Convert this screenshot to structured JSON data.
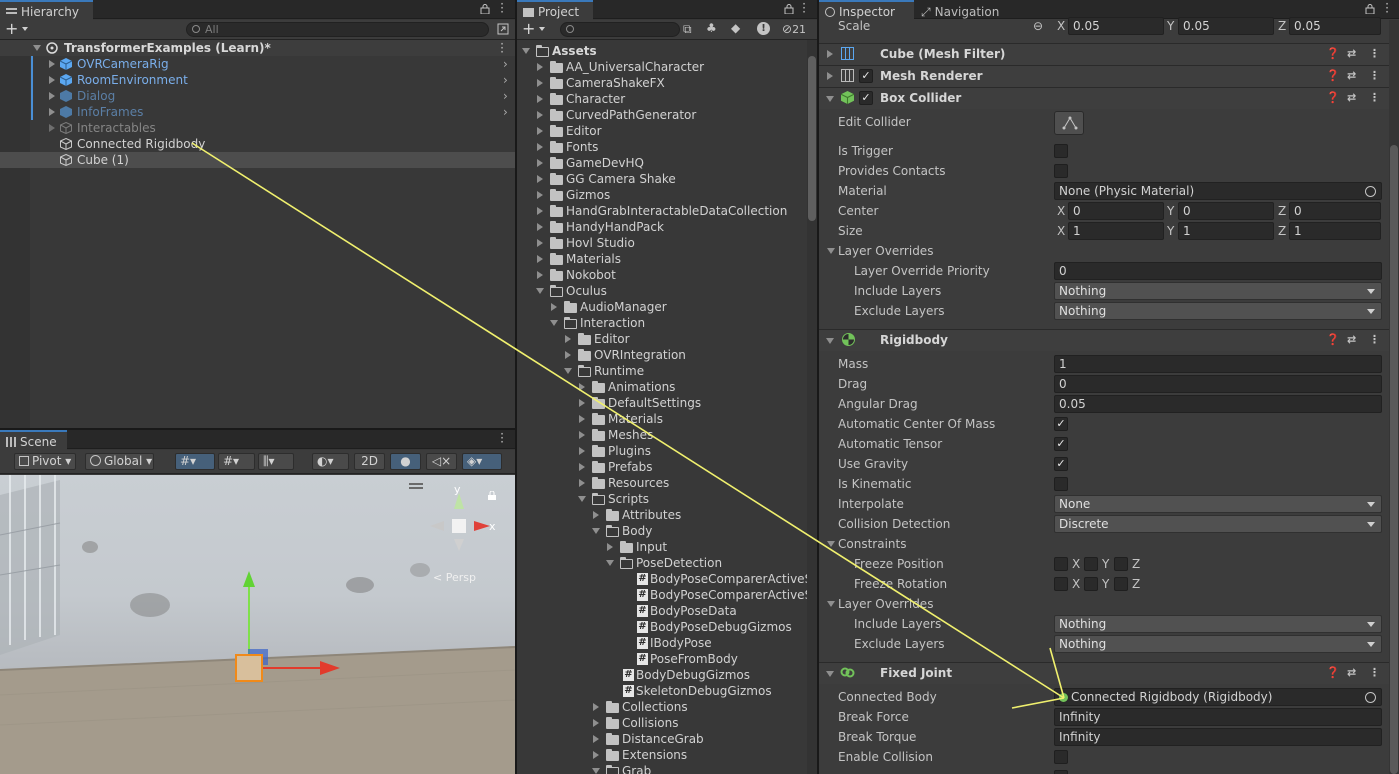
{
  "hierarchy": {
    "tab_label": "Hierarchy",
    "search_placeholder": "All",
    "scene_name": "TransformerExamples (Learn)*",
    "items": [
      {
        "label": "OVRCameraRig"
      },
      {
        "label": "RoomEnvironment"
      },
      {
        "label": "Dialog"
      },
      {
        "label": "InfoFrames"
      },
      {
        "label": "Interactables"
      },
      {
        "label": "Connected Rigidbody"
      },
      {
        "label": "Cube (1)"
      }
    ]
  },
  "scene": {
    "tab_label": "Scene",
    "pivot_label": "Pivot",
    "global_label": "Global",
    "mode_2d": "2D",
    "persp_label": "< Persp",
    "gizmo_x": "x",
    "gizmo_y": "y"
  },
  "project": {
    "tab_label": "Project",
    "hidden_count": "21",
    "root": "Assets",
    "items": [
      {
        "label": "AA_UniversalCharacter"
      },
      {
        "label": "CameraShakeFX"
      },
      {
        "label": "Character"
      },
      {
        "label": "CurvedPathGenerator"
      },
      {
        "label": "Editor"
      },
      {
        "label": "Fonts"
      },
      {
        "label": "GameDevHQ"
      },
      {
        "label": "GG Camera Shake"
      },
      {
        "label": "Gizmos"
      },
      {
        "label": "HandGrabInteractableDataCollection"
      },
      {
        "label": "HandyHandPack"
      },
      {
        "label": "Hovl Studio"
      },
      {
        "label": "Materials"
      },
      {
        "label": "Nokobot"
      },
      {
        "label": "Oculus"
      },
      {
        "label": "AudioManager"
      },
      {
        "label": "Interaction"
      },
      {
        "label": "Editor"
      },
      {
        "label": "OVRIntegration"
      },
      {
        "label": "Runtime"
      },
      {
        "label": "Animations"
      },
      {
        "label": "DefaultSettings"
      },
      {
        "label": "Materials"
      },
      {
        "label": "Meshes"
      },
      {
        "label": "Plugins"
      },
      {
        "label": "Prefabs"
      },
      {
        "label": "Resources"
      },
      {
        "label": "Scripts"
      },
      {
        "label": "Attributes"
      },
      {
        "label": "Body"
      },
      {
        "label": "Input"
      },
      {
        "label": "PoseDetection"
      },
      {
        "label": "BodyPoseComparerActiveS"
      },
      {
        "label": "BodyPoseComparerActiveS"
      },
      {
        "label": "BodyPoseData"
      },
      {
        "label": "BodyPoseDebugGizmos"
      },
      {
        "label": "IBodyPose"
      },
      {
        "label": "PoseFromBody"
      },
      {
        "label": "BodyDebugGizmos"
      },
      {
        "label": "SkeletonDebugGizmos"
      },
      {
        "label": "Collections"
      },
      {
        "label": "Collisions"
      },
      {
        "label": "DistanceGrab"
      },
      {
        "label": "Extensions"
      },
      {
        "label": "Grab"
      }
    ]
  },
  "inspector": {
    "tab_label": "Inspector",
    "nav_tab_label": "Navigation",
    "scale": {
      "label": "Scale",
      "x": "0.05",
      "y": "0.05",
      "z": "0.05"
    },
    "axes": {
      "x": "X",
      "y": "Y",
      "z": "Z"
    },
    "mesh_filter": {
      "title": "Cube (Mesh Filter)"
    },
    "mesh_renderer": {
      "title": "Mesh Renderer"
    },
    "box_collider": {
      "title": "Box Collider",
      "edit_collider": "Edit Collider",
      "is_trigger": "Is Trigger",
      "provides_contacts": "Provides Contacts",
      "material_label": "Material",
      "material_value": "None (Physic Material)",
      "center_label": "Center",
      "center": {
        "x": "0",
        "y": "0",
        "z": "0"
      },
      "size_label": "Size",
      "size": {
        "x": "1",
        "y": "1",
        "z": "1"
      },
      "layer_overrides": "Layer Overrides",
      "priority_label": "Layer Override Priority",
      "priority_value": "0",
      "include_label": "Include Layers",
      "include_value": "Nothing",
      "exclude_label": "Exclude Layers",
      "exclude_value": "Nothing"
    },
    "rigidbody": {
      "title": "Rigidbody",
      "mass_label": "Mass",
      "mass": "1",
      "drag_label": "Drag",
      "drag": "0",
      "angular_drag_label": "Angular Drag",
      "angular_drag": "0.05",
      "auto_com_label": "Automatic Center Of Mass",
      "auto_tensor_label": "Automatic Tensor",
      "use_gravity_label": "Use Gravity",
      "is_kinematic_label": "Is Kinematic",
      "interpolate_label": "Interpolate",
      "interpolate": "None",
      "collision_label": "Collision Detection",
      "collision": "Discrete",
      "constraints_label": "Constraints",
      "freeze_pos_label": "Freeze Position",
      "freeze_rot_label": "Freeze Rotation",
      "layer_overrides": "Layer Overrides",
      "include_label": "Include Layers",
      "include_value": "Nothing",
      "exclude_label": "Exclude Layers",
      "exclude_value": "Nothing"
    },
    "fixed_joint": {
      "title": "Fixed Joint",
      "connected_label": "Connected Body",
      "connected_value": "Connected Rigidbody (Rigidbody)",
      "break_force_label": "Break Force",
      "break_force": "Infinity",
      "break_torque_label": "Break Torque",
      "break_torque": "Infinity",
      "enable_collision_label": "Enable Collision"
    },
    "check_mark": "✓",
    "annotation_color": "#f0f06e"
  }
}
